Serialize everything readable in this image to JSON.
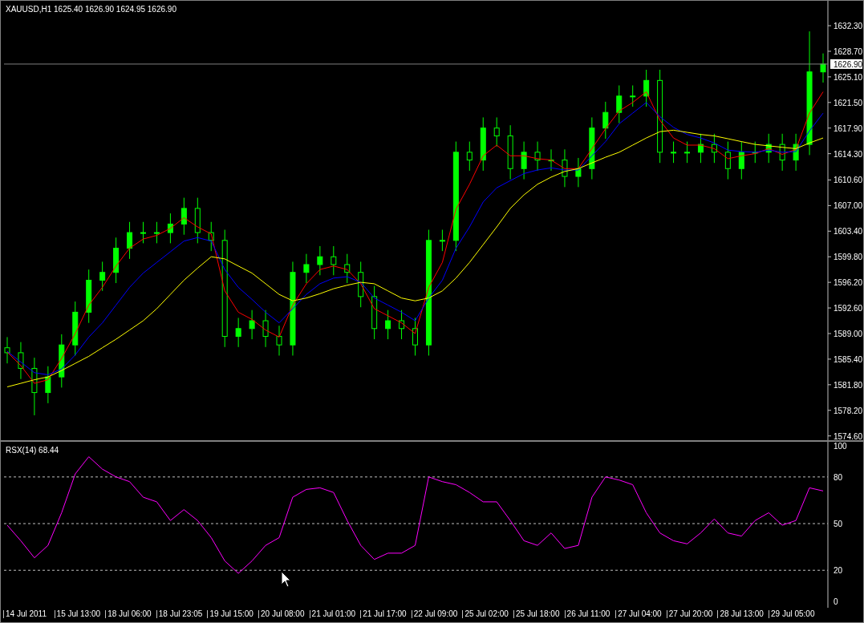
{
  "main_chart": {
    "title": "XAUUSD,H1  1625.40 1626.90 1624.95 1626.90",
    "chart_data": {
      "type": "candlestick",
      "ylim": [
        1574.0,
        1635.8
      ],
      "ref_lines": [
        {
          "axis": "y",
          "value": 1626.9,
          "label": "1626.90",
          "color": "#808080"
        }
      ],
      "yticks": [
        {
          "value": 1632.3,
          "label": "1632.30"
        },
        {
          "value": 1628.7,
          "label": "1628.70"
        },
        {
          "value": 1625.1,
          "label": "1625.10"
        },
        {
          "value": 1621.5,
          "label": "1621.50"
        },
        {
          "value": 1617.9,
          "label": "1617.90"
        },
        {
          "value": 1614.3,
          "label": "1614.30"
        },
        {
          "value": 1610.6,
          "label": "1610.60"
        },
        {
          "value": 1607.0,
          "label": "1607.00"
        },
        {
          "value": 1603.4,
          "label": "1603.40"
        },
        {
          "value": 1599.8,
          "label": "1599.80"
        },
        {
          "value": 1596.2,
          "label": "1596.20"
        },
        {
          "value": 1592.6,
          "label": "1592.60"
        },
        {
          "value": 1589.0,
          "label": "1589.00"
        },
        {
          "value": 1585.4,
          "label": "1585.40"
        },
        {
          "value": 1581.8,
          "label": "1581.80"
        },
        {
          "value": 1578.2,
          "label": "1578.20"
        },
        {
          "value": 1574.6,
          "label": "1574.60"
        }
      ],
      "color": "#00ff00",
      "ohlc": [
        [
          1587.0,
          1588.5,
          1584.8,
          1586.3
        ],
        [
          1586.3,
          1587.8,
          1582.6,
          1584.1
        ],
        [
          1584.1,
          1585.6,
          1577.5,
          1580.7
        ],
        [
          1580.7,
          1584.4,
          1579.2,
          1582.9
        ],
        [
          1582.9,
          1588.9,
          1581.4,
          1587.4
        ],
        [
          1587.4,
          1593.5,
          1585.9,
          1592.0
        ],
        [
          1592.0,
          1598.0,
          1590.5,
          1596.5
        ],
        [
          1596.5,
          1599.1,
          1595.0,
          1597.6
        ],
        [
          1597.6,
          1602.5,
          1596.1,
          1601.0
        ],
        [
          1601.0,
          1604.7,
          1599.5,
          1603.2
        ],
        [
          1603.2,
          1604.7,
          1601.7,
          1603.2
        ],
        [
          1603.2,
          1604.7,
          1601.7,
          1603.2
        ],
        [
          1603.2,
          1605.9,
          1601.7,
          1604.4
        ],
        [
          1604.4,
          1608.1,
          1602.9,
          1606.6
        ],
        [
          1606.6,
          1608.1,
          1601.7,
          1603.2
        ],
        [
          1603.2,
          1604.7,
          1600.6,
          1602.1
        ],
        [
          1602.1,
          1603.6,
          1587.1,
          1588.6
        ],
        [
          1588.6,
          1591.2,
          1587.1,
          1589.7
        ],
        [
          1589.7,
          1592.3,
          1588.2,
          1590.8
        ],
        [
          1590.8,
          1592.3,
          1587.1,
          1588.6
        ],
        [
          1588.6,
          1590.1,
          1585.9,
          1587.4
        ],
        [
          1587.4,
          1599.1,
          1585.9,
          1597.6
        ],
        [
          1597.6,
          1600.2,
          1596.1,
          1598.7
        ],
        [
          1598.7,
          1601.3,
          1597.2,
          1599.8
        ],
        [
          1599.8,
          1601.3,
          1597.2,
          1598.7
        ],
        [
          1598.7,
          1600.2,
          1596.1,
          1597.6
        ],
        [
          1597.6,
          1599.1,
          1592.7,
          1594.2
        ],
        [
          1594.2,
          1595.7,
          1588.2,
          1589.7
        ],
        [
          1589.7,
          1592.3,
          1588.2,
          1590.8
        ],
        [
          1590.8,
          1592.3,
          1588.2,
          1589.7
        ],
        [
          1589.7,
          1591.2,
          1585.9,
          1587.4
        ],
        [
          1587.4,
          1603.6,
          1585.9,
          1602.1
        ],
        [
          1602.1,
          1603.6,
          1600.6,
          1602.1
        ],
        [
          1602.1,
          1616.0,
          1600.6,
          1614.5
        ],
        [
          1614.5,
          1616.0,
          1611.9,
          1613.4
        ],
        [
          1613.4,
          1619.4,
          1611.9,
          1617.9
        ],
        [
          1617.9,
          1619.4,
          1615.3,
          1616.8
        ],
        [
          1616.8,
          1618.3,
          1610.7,
          1612.2
        ],
        [
          1612.2,
          1616.0,
          1610.7,
          1614.5
        ],
        [
          1614.5,
          1616.0,
          1611.9,
          1613.4
        ],
        [
          1613.4,
          1614.9,
          1611.9,
          1613.4
        ],
        [
          1613.4,
          1614.9,
          1609.6,
          1611.1
        ],
        [
          1611.1,
          1613.7,
          1609.6,
          1612.2
        ],
        [
          1612.2,
          1619.4,
          1610.7,
          1617.9
        ],
        [
          1617.9,
          1621.6,
          1616.4,
          1620.1
        ],
        [
          1620.1,
          1623.9,
          1618.6,
          1622.4
        ],
        [
          1622.4,
          1623.9,
          1620.9,
          1622.4
        ],
        [
          1622.4,
          1626.1,
          1620.9,
          1624.6
        ],
        [
          1624.6,
          1626.1,
          1613.0,
          1614.5
        ],
        [
          1614.5,
          1616.0,
          1613.0,
          1614.5
        ],
        [
          1614.5,
          1616.0,
          1613.0,
          1614.5
        ],
        [
          1614.5,
          1617.1,
          1613.0,
          1615.6
        ],
        [
          1615.6,
          1617.1,
          1613.0,
          1614.5
        ],
        [
          1614.5,
          1616.0,
          1610.7,
          1612.2
        ],
        [
          1612.2,
          1616.0,
          1610.7,
          1614.5
        ],
        [
          1614.5,
          1616.0,
          1613.0,
          1614.5
        ],
        [
          1614.5,
          1617.1,
          1613.0,
          1615.6
        ],
        [
          1615.6,
          1617.1,
          1611.9,
          1613.4
        ],
        [
          1613.4,
          1617.1,
          1611.9,
          1615.6
        ],
        [
          1615.6,
          1631.5,
          1614.1,
          1625.8
        ],
        [
          1625.8,
          1628.4,
          1624.3,
          1626.9
        ]
      ],
      "series": [
        {
          "type": "line",
          "color": "#ff0000",
          "values": [
            1586.4,
            1584.5,
            1582.0,
            1582.5,
            1585.5,
            1589.0,
            1593.0,
            1595.5,
            1598.5,
            1601.0,
            1602.3,
            1602.8,
            1603.8,
            1605.3,
            1604.0,
            1603.0,
            1595.0,
            1592.0,
            1591.0,
            1589.5,
            1588.5,
            1593.0,
            1596.0,
            1598.0,
            1598.5,
            1598.0,
            1596.0,
            1592.5,
            1591.5,
            1590.5,
            1589.0,
            1595.5,
            1599.0,
            1606.5,
            1610.0,
            1614.0,
            1615.5,
            1614.0,
            1614.0,
            1613.6,
            1613.4,
            1612.2,
            1612.2,
            1615.0,
            1617.8,
            1620.3,
            1621.5,
            1623.0,
            1619.0,
            1616.5,
            1615.5,
            1615.5,
            1615.0,
            1613.6,
            1614.0,
            1614.3,
            1615.0,
            1614.2,
            1614.9,
            1620.0,
            1623.0
          ]
        },
        {
          "type": "line",
          "color": "#0000ff",
          "values": [
            1586.5,
            1585.0,
            1583.5,
            1583.2,
            1584.0,
            1586.0,
            1588.5,
            1590.5,
            1593.0,
            1595.5,
            1597.5,
            1599.0,
            1600.5,
            1602.0,
            1602.5,
            1602.0,
            1598.0,
            1595.5,
            1593.8,
            1592.0,
            1590.5,
            1592.5,
            1594.5,
            1596.0,
            1596.8,
            1597.0,
            1596.2,
            1594.0,
            1593.0,
            1592.0,
            1590.8,
            1594.0,
            1596.5,
            1601.0,
            1604.0,
            1607.5,
            1609.5,
            1610.5,
            1611.5,
            1612.0,
            1612.3,
            1612.0,
            1612.0,
            1614.0,
            1616.0,
            1618.5,
            1620.0,
            1621.5,
            1619.5,
            1618.0,
            1617.0,
            1616.5,
            1615.8,
            1614.8,
            1614.6,
            1614.5,
            1614.8,
            1614.5,
            1614.6,
            1617.5,
            1620.0
          ]
        },
        {
          "type": "line",
          "color": "#ffff00",
          "values": [
            1581.5,
            1582.0,
            1582.5,
            1582.9,
            1583.8,
            1584.8,
            1585.8,
            1587.0,
            1588.2,
            1589.5,
            1590.8,
            1592.5,
            1594.5,
            1596.5,
            1598.2,
            1599.8,
            1599.5,
            1598.5,
            1597.5,
            1596.0,
            1594.5,
            1593.6,
            1594.0,
            1594.6,
            1595.3,
            1595.8,
            1596.2,
            1596.0,
            1595.0,
            1594.0,
            1593.6,
            1594.0,
            1595.0,
            1596.8,
            1599.0,
            1601.5,
            1604.0,
            1606.6,
            1608.5,
            1610.0,
            1611.0,
            1611.8,
            1612.2,
            1613.0,
            1613.8,
            1614.5,
            1615.5,
            1616.5,
            1617.4,
            1617.6,
            1617.3,
            1617.0,
            1616.8,
            1616.4,
            1616.0,
            1615.6,
            1615.4,
            1615.2,
            1615.0,
            1615.8,
            1616.5
          ]
        }
      ]
    }
  },
  "indicator": {
    "title": "RSX(14) 68.44",
    "chart_data": {
      "type": "line",
      "ylim": [
        -4.1,
        102.6
      ],
      "yticks": [
        0,
        20,
        50,
        80,
        100
      ],
      "grid": true,
      "series": [
        {
          "color": "#ff00ff",
          "values": [
            49,
            39,
            28,
            36,
            57,
            82,
            93,
            85,
            80,
            77,
            67,
            64,
            52,
            59,
            52,
            41,
            26,
            18,
            26,
            36,
            41,
            67,
            72,
            73,
            70,
            52,
            36,
            27,
            31,
            31,
            36,
            80,
            77,
            75,
            70,
            64,
            64,
            52,
            39,
            36,
            44,
            34,
            36,
            67,
            80,
            78,
            75,
            57,
            44,
            39,
            37,
            44,
            53,
            44,
            42,
            52,
            57,
            49,
            52,
            73,
            71
          ]
        }
      ]
    }
  },
  "time_axis": [
    "14 Jul 2011",
    "15 Jul 13:00",
    "18 Jul 06:00",
    "18 Jul 23:05",
    "19 Jul 15:00",
    "20 Jul 08:00",
    "21 Jul 01:00",
    "21 Jul 17:00",
    "22 Jul 09:00",
    "25 Jul 02:00",
    "25 Jul 18:00",
    "26 Jul 11:00",
    "27 Jul 04:00",
    "27 Jul 20:00",
    "28 Jul 13:00",
    "29 Jul 05:00"
  ]
}
